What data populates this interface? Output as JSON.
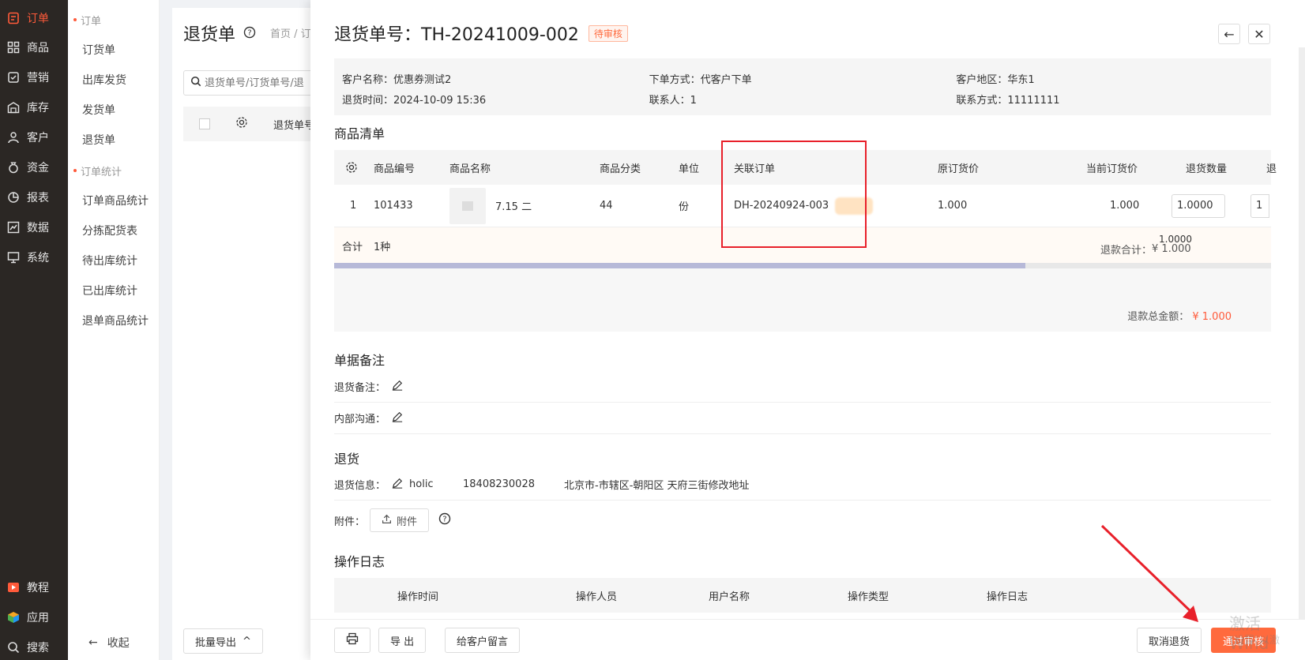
{
  "nav": {
    "items": [
      {
        "label": "订单",
        "icon": "order-icon",
        "active": true
      },
      {
        "label": "商品",
        "icon": "grid-icon"
      },
      {
        "label": "营销",
        "icon": "marketing-icon"
      },
      {
        "label": "库存",
        "icon": "warehouse-icon"
      },
      {
        "label": "客户",
        "icon": "user-icon"
      },
      {
        "label": "资金",
        "icon": "money-bag-icon"
      },
      {
        "label": "报表",
        "icon": "pie-chart-icon"
      },
      {
        "label": "数据",
        "icon": "data-chart-icon"
      },
      {
        "label": "系统",
        "icon": "monitor-icon"
      }
    ],
    "bottom": [
      {
        "label": "教程",
        "icon": "video-icon"
      },
      {
        "label": "应用",
        "icon": "cube-icon"
      },
      {
        "label": "搜索",
        "icon": "search-icon"
      }
    ]
  },
  "subnav": {
    "group1": "订单",
    "items1": [
      "订货单",
      "出库发货",
      "发货单",
      "退货单"
    ],
    "group2": "订单统计",
    "items2": [
      "订单商品统计",
      "分拣配货表",
      "待出库统计",
      "已出库统计",
      "退单商品统计"
    ],
    "collapse": "收起"
  },
  "list": {
    "title": "退货单",
    "breadcrumb": "首页 / 订",
    "search_placeholder": "退货单号/订货单号/退",
    "col_head": "退货单号",
    "batch_export": "批量导出"
  },
  "drawer": {
    "title": "退货单号：TH-20241009-002",
    "status": "待审核",
    "info": {
      "customer_name": "客户名称：优惠券测试2",
      "order_method": "下单方式：代客户下单",
      "customer_region": "客户地区：华东1",
      "return_time": "退货时间：2024-10-09 15:36",
      "contact": "联系人：1",
      "contact_method": "联系方式：11111111"
    },
    "goods_title": "商品清单",
    "goods_headers": {
      "code": "商品编号",
      "name": "商品名称",
      "category": "商品分类",
      "unit": "单位",
      "related_order": "关联订单",
      "orig_price": "原订货价",
      "cur_price": "当前订货价",
      "return_qty": "退货数量",
      "extra": "退"
    },
    "goods_rows": [
      {
        "index": "1",
        "code": "101433",
        "name": "7.15 二",
        "category": "44",
        "unit": "份",
        "related_order": "DH-20240924-003",
        "orig_price": "1.000",
        "cur_price": "1.000",
        "return_qty": "1.0000",
        "extra": "1"
      }
    ],
    "sum": {
      "label": "合计",
      "kinds": "1种",
      "qty": "1.0000",
      "refund_total_label": "退款合计：",
      "refund_total": "¥ 1.000"
    },
    "refund_sum_label": "退款总金额：",
    "refund_sum": "¥ 1.000",
    "remark_title": "单据备注",
    "return_remark_label": "退货备注：",
    "internal_label": "内部沟通：",
    "return_title": "退货",
    "return_info_label": "退货信息：",
    "return_person": "holic",
    "return_phone": "18408230028",
    "return_address": "北京市-市辖区-朝阳区 天府三街修改地址",
    "attach_label": "附件：",
    "attach_btn": "附件",
    "log_title": "操作日志",
    "log_headers": [
      "操作时间",
      "操作人员",
      "用户名称",
      "操作类型",
      "操作日志"
    ],
    "footer": {
      "export": "导 出",
      "message": "给客户留言",
      "cancel": "取消退货",
      "approve": "通过审核"
    }
  },
  "watermark": {
    "title": "激活 Wind",
    "sub": "\"设置\"以激"
  },
  "colors": {
    "accent": "#ff6a3d",
    "nav_bg": "#2b2724",
    "highlight": "#e8202a"
  }
}
